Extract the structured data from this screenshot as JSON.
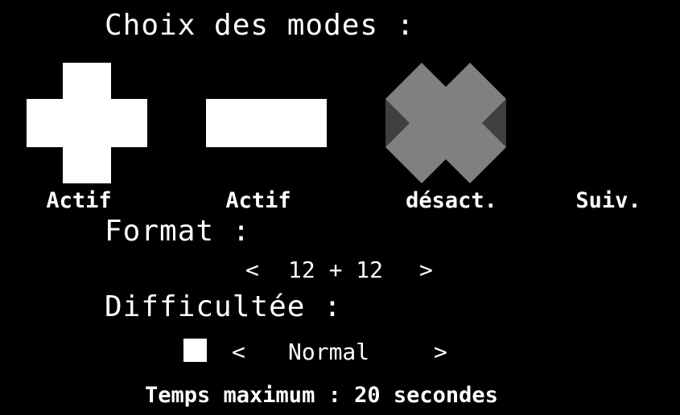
{
  "title": "Choix des modes :",
  "modes": [
    {
      "icon": "plus-icon",
      "label": "Actif",
      "state": "active"
    },
    {
      "icon": "minus-icon",
      "label": "Actif",
      "state": "active"
    },
    {
      "icon": "multiply-icon",
      "label": "désact.",
      "state": "disabled"
    }
  ],
  "next_label": "Suiv.",
  "format": {
    "heading": "Format :",
    "prev_arrow": "<",
    "value": "12 + 12",
    "next_arrow": ">"
  },
  "difficulty": {
    "heading": "Difficultée :",
    "prev_arrow": "<",
    "value": "Normal",
    "next_arrow": ">"
  },
  "footer": "Temps maximum : 20 secondes",
  "colors": {
    "background": "#000000",
    "foreground": "#ffffff",
    "disabled": "#808080",
    "disabled_shadow": "#404040"
  }
}
